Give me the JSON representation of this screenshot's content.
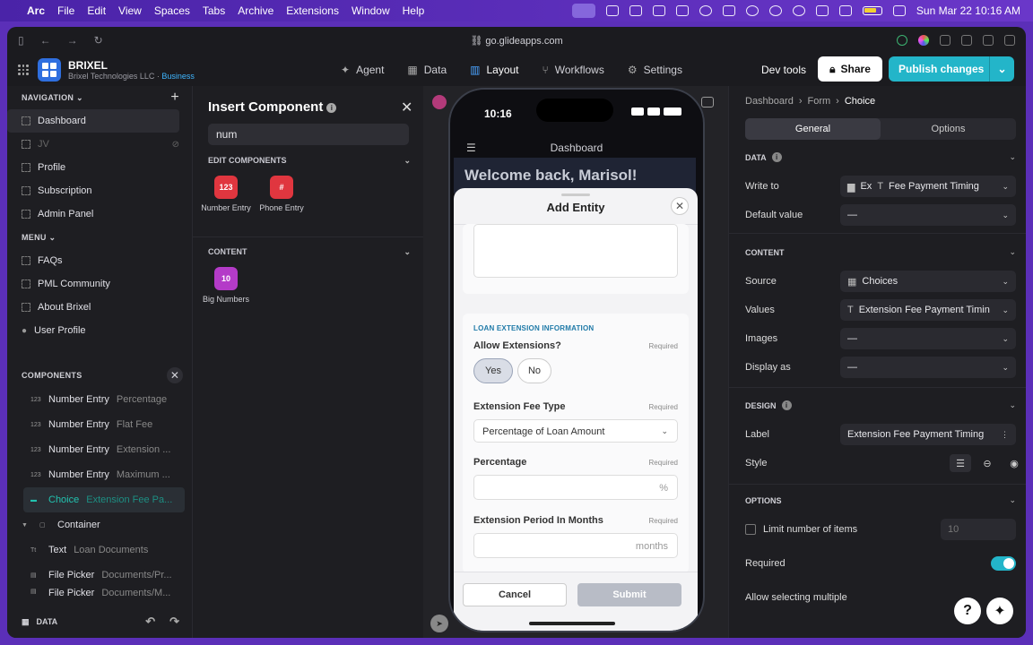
{
  "menubar": {
    "apple": "",
    "items": [
      "Arc",
      "File",
      "Edit",
      "View",
      "Spaces",
      "Tabs",
      "Archive",
      "Extensions",
      "Window",
      "Help"
    ],
    "datetime": "Sun Mar 22  10:16 AM"
  },
  "browser": {
    "url": "go.glideapps.com"
  },
  "app": {
    "name": "BRIXEL",
    "org": "Brixel Technologies LLC · ",
    "plan": "Business",
    "tabs": [
      {
        "icon": "✦",
        "label": "Agent"
      },
      {
        "icon": "▦",
        "label": "Data"
      },
      {
        "icon": "▥",
        "label": "Layout"
      },
      {
        "icon": "⑂",
        "label": "Workflows"
      },
      {
        "icon": "⚙",
        "label": "Settings"
      }
    ],
    "dev_tools": "Dev tools",
    "share": "Share",
    "publish": "Publish changes"
  },
  "navigation": {
    "header": "NAVIGATION",
    "items": [
      {
        "label": "Dashboard",
        "active": true
      },
      {
        "label": "JV",
        "hidden": true
      },
      {
        "label": "Profile"
      },
      {
        "label": "Subscription"
      },
      {
        "label": "Admin Panel"
      }
    ],
    "menu_header": "MENU",
    "menu_items": [
      {
        "label": "FAQs"
      },
      {
        "label": "PML Community"
      },
      {
        "label": "About Brixel"
      },
      {
        "label": "User Profile"
      }
    ]
  },
  "components": {
    "header": "COMPONENTS",
    "items": [
      {
        "type": "Number Entry",
        "sub": "Percentage",
        "icon": "123"
      },
      {
        "type": "Number Entry",
        "sub": "Flat Fee",
        "icon": "123"
      },
      {
        "type": "Number Entry",
        "sub": "Extension ...",
        "icon": "123"
      },
      {
        "type": "Number Entry",
        "sub": "Maximum ...",
        "icon": "123"
      },
      {
        "type": "Choice",
        "sub": "Extension Fee Pa...",
        "icon": "▬",
        "selected": true
      },
      {
        "type": "Container",
        "sub": "",
        "icon": "▢"
      },
      {
        "type": "Text",
        "sub": "Loan Documents",
        "icon": "Tt"
      },
      {
        "type": "File Picker",
        "sub": "Documents/Pr...",
        "icon": "▤"
      },
      {
        "type": "File Picker",
        "sub": "Documents/M...",
        "icon": "▤"
      }
    ],
    "footer": "DATA"
  },
  "insert": {
    "title": "Insert Component",
    "search_value": "num",
    "edit_header": "EDIT COMPONENTS",
    "edit_tiles": [
      {
        "label": "Number Entry",
        "icon": "123",
        "color": "#e0363f"
      },
      {
        "label": "Phone Entry",
        "icon": "#",
        "color": "#e0363f"
      }
    ],
    "content_header": "CONTENT",
    "content_tiles": [
      {
        "label": "Big Numbers",
        "icon": "10",
        "color": "#b43bc8"
      }
    ]
  },
  "phone": {
    "time": "10:16",
    "screen_title": "Dashboard",
    "welcome": "Welcome back, Marisol!",
    "sheet": {
      "title": "Add Entity",
      "section": "LOAN EXTENSION INFORMATION",
      "allow_label": "Allow Extensions?",
      "required": "Required",
      "yes": "Yes",
      "no": "No",
      "fee_type_label": "Extension Fee Type",
      "fee_type_value": "Percentage of Loan Amount",
      "percentage_label": "Percentage",
      "percentage_suffix": "%",
      "period_label": "Extension Period In Months",
      "period_suffix": "months",
      "cancel": "Cancel",
      "submit": "Submit"
    }
  },
  "props": {
    "breadcrumb": [
      "Dashboard",
      "Form",
      "Choice"
    ],
    "tabs": [
      "General",
      "Options"
    ],
    "data_header": "DATA",
    "write_to_label": "Write to",
    "write_to_table": "Ex",
    "write_to_column": "Fee Payment Timing",
    "default_label": "Default value",
    "default_value": "—",
    "content_header": "CONTENT",
    "source_label": "Source",
    "source_value": "Choices",
    "values_label": "Values",
    "values_value": "Extension Fee Payment Timin",
    "images_label": "Images",
    "images_value": "—",
    "display_label": "Display as",
    "display_value": "—",
    "design_header": "DESIGN",
    "label_label": "Label",
    "label_value": "Extension Fee Payment Timing",
    "style_label": "Style",
    "options_header": "OPTIONS",
    "limit_label": "Limit number of items",
    "limit_value": "10",
    "required_label": "Required",
    "multiple_label": "Allow selecting multiple"
  }
}
